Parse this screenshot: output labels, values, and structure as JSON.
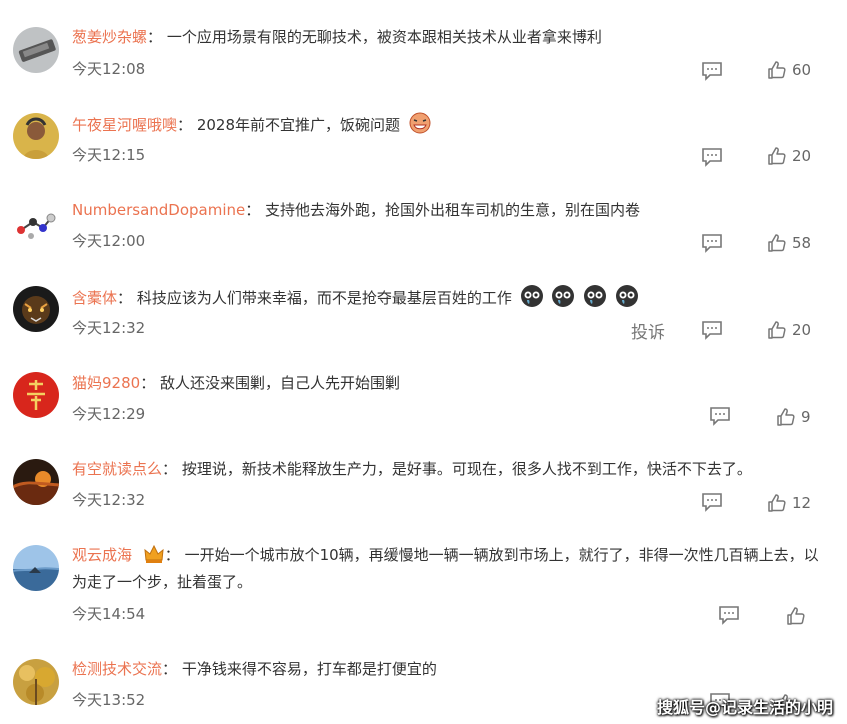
{
  "comments": [
    {
      "user": "葱姜炒杂螺",
      "text": "一个应用场景有限的无聊技术，被资本跟相关技术从业者拿来博利",
      "time": "今天12:08",
      "likes": "60"
    },
    {
      "user": "午夜星河喔哦噢",
      "text": "2028年前不宜推广，饭碗问题",
      "time": "今天12:15",
      "likes": "20"
    },
    {
      "user": "NumbersandDopamine",
      "text": "支持他去海外跑，抢国外出租车司机的生意，别在国内卷",
      "time": "今天12:00",
      "likes": "58"
    },
    {
      "user": "含橐体",
      "text": "科技应该为人们带来幸福，而不是抢夺最基层百姓的工作",
      "time": "今天12:32",
      "likes": "20",
      "report": "投诉"
    },
    {
      "user": "猫妈9280",
      "text": "敌人还没来围剿，自己人先开始围剿",
      "time": "今天12:29",
      "likes": "9"
    },
    {
      "user": "有空就读点么",
      "text": "按理说，新技术能释放生产力，是好事。可现在，很多人找不到工作，快活不下去了。",
      "time": "今天12:32",
      "likes": "12"
    },
    {
      "user": "观云成海",
      "text": "一开始一个城市放个10辆，再缓慢地一辆一辆放到市场上，就行了，非得一次性几百辆上去，以为走了一个步，扯着蛋了。",
      "time": "今天14:54",
      "likes": ""
    },
    {
      "user": "检测技术交流",
      "text": "干净钱来得不容易，打车都是打便宜的",
      "time": "今天13:52",
      "likes": ""
    }
  ],
  "colon": "：",
  "watermark": "搜狐号@记录生活的小明",
  "icons": {
    "reply": "comment-reply-icon",
    "like": "thumbs-up-icon",
    "cry": "crying-face-icon",
    "crown": "crown-badge-icon"
  },
  "colors": {
    "username": "#eb7350",
    "text": "#333333",
    "meta": "#666666"
  }
}
